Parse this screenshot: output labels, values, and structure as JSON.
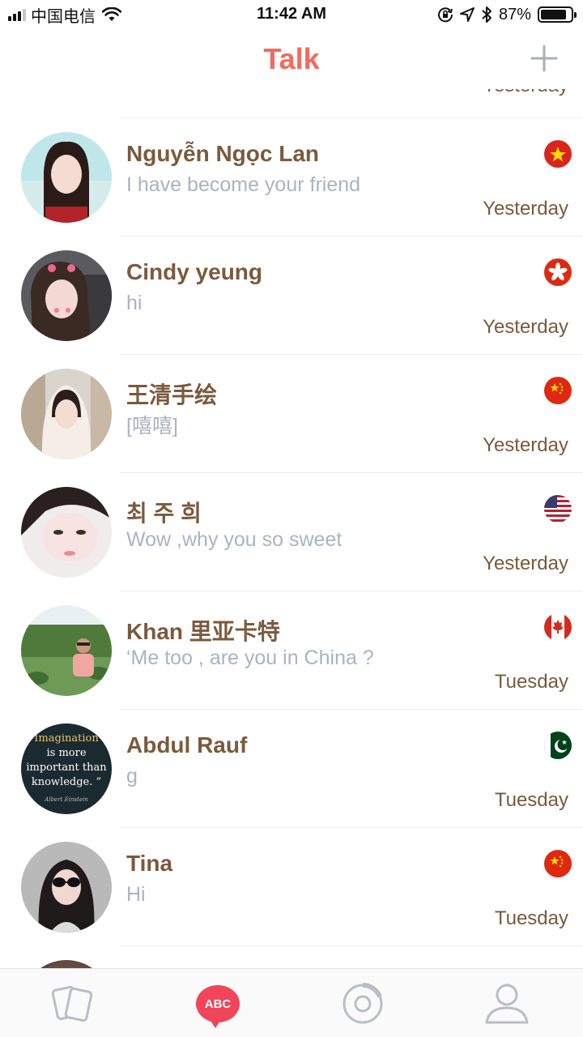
{
  "status_bar": {
    "carrier": "中国电信",
    "time": "11:42 AM",
    "battery": "87%",
    "battery_level": 0.87,
    "icons": [
      "signal-icon",
      "wifi-icon",
      "orientation-lock-icon",
      "location-icon",
      "bluetooth-icon",
      "battery-icon"
    ]
  },
  "header": {
    "title": "Talk",
    "add_icon": "plus-icon"
  },
  "partial_top_row": {
    "time": "Yesterday"
  },
  "conversations": [
    {
      "name": "Nguyễn Ngọc Lan",
      "message": "I have become your friend",
      "time": "Yesterday",
      "flag": "vietnam-flag-icon"
    },
    {
      "name": "Cindy yeung",
      "message": "hi",
      "time": "Yesterday",
      "flag": "hong-kong-flag-icon"
    },
    {
      "name": "王清手绘",
      "message": "[嘻嘻]",
      "time": "Yesterday",
      "flag": "china-flag-icon"
    },
    {
      "name": "최 주 희",
      "message": "Wow ,why you so sweet",
      "time": "Yesterday",
      "flag": "usa-flag-icon"
    },
    {
      "name": "Khan 里亚卡特",
      "message": "‘Me too , are you in China ?",
      "time": "Tuesday",
      "flag": "canada-flag-icon"
    },
    {
      "name": "Abdul Rauf",
      "message": "g",
      "time": "Tuesday",
      "flag": "pakistan-flag-icon",
      "avatar_text": [
        "Imagination",
        "is more",
        "important than",
        "knowledge. ”",
        "Albert Einstein"
      ]
    },
    {
      "name": "Tina",
      "message": "Hi",
      "time": "Tuesday",
      "flag": "china-flag-icon"
    }
  ],
  "tab_bar": {
    "tabs": [
      {
        "icon": "cards-icon",
        "active": false
      },
      {
        "icon": "abc-chat-icon",
        "label": "ABC",
        "active": true
      },
      {
        "icon": "discover-ring-icon",
        "active": false
      },
      {
        "icon": "profile-icon",
        "active": false
      }
    ]
  },
  "colors": {
    "accent": "#f46a5d",
    "name": "#7a5a3d",
    "message": "#aab3c2",
    "tab_active": "#f0455a",
    "tab_inactive": "#b9bec6"
  }
}
